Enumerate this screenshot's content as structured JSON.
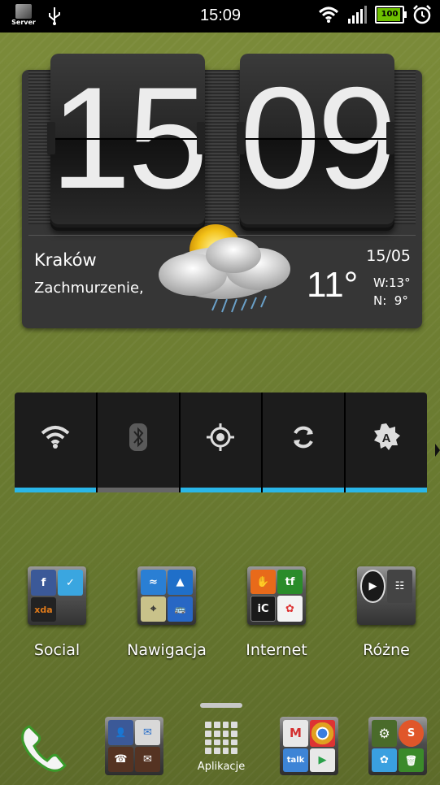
{
  "statusbar": {
    "time": "15:09",
    "battery": "100",
    "server_label": "Server"
  },
  "clock": {
    "hours": "15",
    "minutes": "09"
  },
  "weather": {
    "city": "Kraków",
    "condition": "Zachmurzenie,",
    "date": "15/05",
    "temperature": "11°",
    "high": "W:13°",
    "low": "N:  9°"
  },
  "power_widget": {
    "toggles": [
      {
        "name": "wifi",
        "icon": "wifi-icon",
        "bar_color": "#2ab6e8"
      },
      {
        "name": "bluetooth",
        "icon": "bluetooth-icon",
        "bar_color": "#666666"
      },
      {
        "name": "gps",
        "icon": "gps-icon",
        "bar_color": "#2ab6e8"
      },
      {
        "name": "sync",
        "icon": "sync-icon",
        "bar_color": "#2ab6e8"
      },
      {
        "name": "brightness",
        "icon": "brightness-auto-icon",
        "bar_color": "#2ab6e8"
      }
    ]
  },
  "folders": [
    {
      "label": "Social",
      "icons": [
        {
          "name": "facebook-icon",
          "text": "f",
          "color": "#3b5998"
        },
        {
          "name": "tasks-icon",
          "text": "✓",
          "color": "#3aa6e0"
        },
        {
          "name": "xda-icon",
          "text": "xda",
          "color": "#222222"
        },
        {
          "name": "empty-slot",
          "text": "",
          "color": "transparent"
        }
      ]
    },
    {
      "label": "Nawigacja",
      "icons": [
        {
          "name": "maps-icon",
          "text": "≈",
          "color": "#2a7fd4"
        },
        {
          "name": "navigation-icon",
          "text": "▲",
          "color": "#1f6fc9"
        },
        {
          "name": "local-map-icon",
          "text": "⌖",
          "color": "#c9c28a"
        },
        {
          "name": "transit-icon",
          "text": "🚌",
          "color": "#2867c4"
        }
      ]
    },
    {
      "label": "Internet",
      "icons": [
        {
          "name": "hand-app-icon",
          "text": "✋",
          "color": "#e86a1a"
        },
        {
          "name": "tf-icon",
          "text": "tf",
          "color": "#2a8c2a"
        },
        {
          "name": "ic-icon",
          "text": "iC",
          "color": "#1a1a1a"
        },
        {
          "name": "flower-app-icon",
          "text": "✿",
          "color": "#f3f3f3"
        }
      ]
    },
    {
      "label": "Różne",
      "icons": [
        {
          "name": "play-icon",
          "text": "▶",
          "color": "#1a1a1a"
        },
        {
          "name": "radio-icon",
          "text": "☷",
          "color": "#444444"
        },
        {
          "name": "empty-slot",
          "text": "",
          "color": "transparent"
        },
        {
          "name": "empty-slot",
          "text": "",
          "color": "transparent"
        }
      ]
    }
  ],
  "dock": {
    "apps_label": "Aplikacje",
    "folder1_icons": [
      {
        "name": "contacts-icon",
        "text": "👤",
        "color": "#3b5998"
      },
      {
        "name": "messages-icon",
        "text": "✉",
        "color": "#d8d8d8"
      },
      {
        "name": "contact-photo-icon",
        "text": "☎",
        "color": "#553322"
      },
      {
        "name": "contact-photo2-icon",
        "text": "✉",
        "color": "#553322"
      }
    ],
    "folder2_icons": [
      {
        "name": "gmail-icon",
        "text": "M",
        "color": "#e8e8e8"
      },
      {
        "name": "chrome-icon",
        "text": "◎",
        "color": "#d8d8d8"
      },
      {
        "name": "talk-icon",
        "text": "talk",
        "color": "#3d84d6"
      },
      {
        "name": "play-store-icon",
        "text": "▶",
        "color": "#e8e8e8"
      }
    ],
    "folder3_icons": [
      {
        "name": "settings-icon",
        "text": "⚙",
        "color": "#4a6b2a"
      },
      {
        "name": "swift-icon",
        "text": "S",
        "color": "#e0562a"
      },
      {
        "name": "photo-app-icon",
        "text": "✿",
        "color": "#3aa0e0"
      },
      {
        "name": "trash-icon",
        "text": "🗑",
        "color": "#3b8a2a"
      }
    ]
  }
}
